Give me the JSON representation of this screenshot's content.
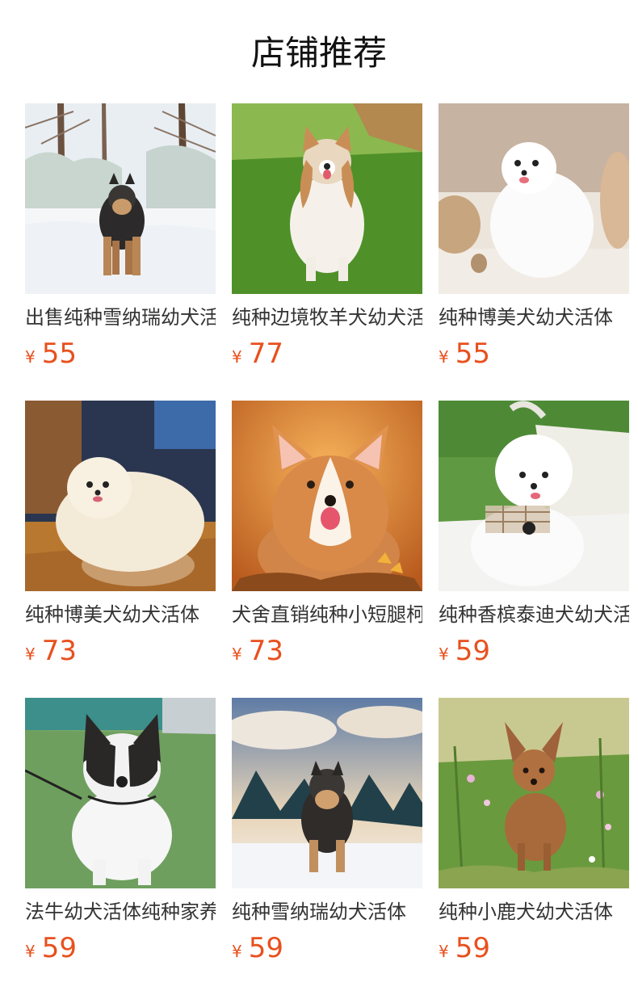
{
  "section_title": "店铺推荐",
  "currency_symbol": "¥",
  "accent_color": "#e8501e",
  "products": [
    {
      "name": "出售纯种雪纳瑞幼犬活体",
      "price": "55",
      "image": "schnauzer-in-snowy-forest-photo"
    },
    {
      "name": "纯种边境牧羊犬幼犬活体",
      "price": "77",
      "image": "border-collie-on-grass-photo"
    },
    {
      "name": "纯种博美犬幼犬活体",
      "price": "55",
      "image": "white-pomeranian-indoors-photo"
    },
    {
      "name": "纯种博美犬幼犬活体",
      "price": "73",
      "image": "cream-pomeranian-on-wood-floor-photo"
    },
    {
      "name": "犬舍直销纯种小短腿柯基",
      "price": "73",
      "image": "corgi-autumn-leaves-photo"
    },
    {
      "name": "纯种香槟泰迪犬幼犬活体",
      "price": "59",
      "image": "white-bichon-with-bag-photo"
    },
    {
      "name": "法牛幼犬活体纯种家养",
      "price": "59",
      "image": "french-bulldog-on-lawn-photo"
    },
    {
      "name": "纯种雪纳瑞幼犬活体",
      "price": "59",
      "image": "schnauzer-in-snow-mountains-photo"
    },
    {
      "name": "纯种小鹿犬幼犬活体",
      "price": "59",
      "image": "min-pin-in-flower-meadow-photo"
    }
  ]
}
